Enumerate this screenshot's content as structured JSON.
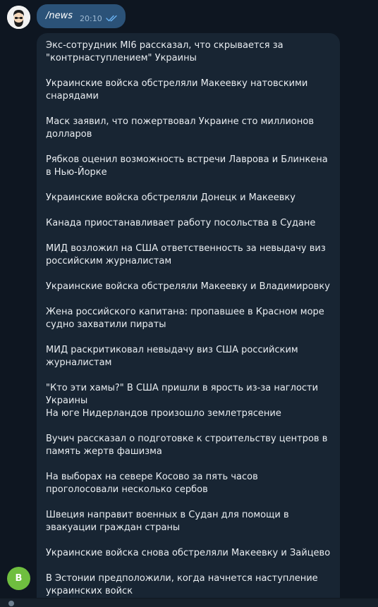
{
  "outgoing": {
    "text": "/news",
    "time": "20:10",
    "status_icon": "double-check-icon"
  },
  "bot": {
    "avatar_letter": "B",
    "avatar_color": "#6fbe3f"
  },
  "news": [
    "Экс-сотрудник MI6 рассказал, что скрывается за \"контрнаступлением\" Украины",
    "Украинские войска обстреляли Макеевку натовскими снарядами",
    "Маск заявил, что пожертвовал Украине сто миллионов долларов",
    "Рябков оценил возможность встречи Лаврова и Блинкена в Нью-Йорке",
    "Украинские войска обстреляли Донецк и Макеевку",
    "Канада приостанавливает работу посольства в Судане",
    "МИД возложил на США ответственность за невыдачу виз российским журналистам",
    "Украинские войска обстреляли Макеевку и Владимировку",
    "Жена российского капитана: пропавшее в Красном море судно захватили пираты",
    "МИД раскритиковал невыдачу виз США российским журналистам",
    "\"Кто эти хамы?\" В США пришли в ярость из-за наглости Украины",
    "На юге Нидерландов произошло землетрясение",
    "Вучич рассказал о подготовке к строительству центров в память жертв фашизма",
    "На выборах на севере Косово за пять часов проголосовали несколько сербов",
    "Швеция направит военных в Судан для помощи в эвакуации граждан страны",
    "Украинские войска снова обстреляли Макеевку и Зайцево",
    "В Эстонии предположили, когда начнется наступление украинских войск"
  ],
  "colors": {
    "background": "#0e1621",
    "outgoing_bubble": "#2b5278",
    "incoming_bubble": "#182533",
    "text": "#e9edf1",
    "time": "#9fbad3"
  }
}
